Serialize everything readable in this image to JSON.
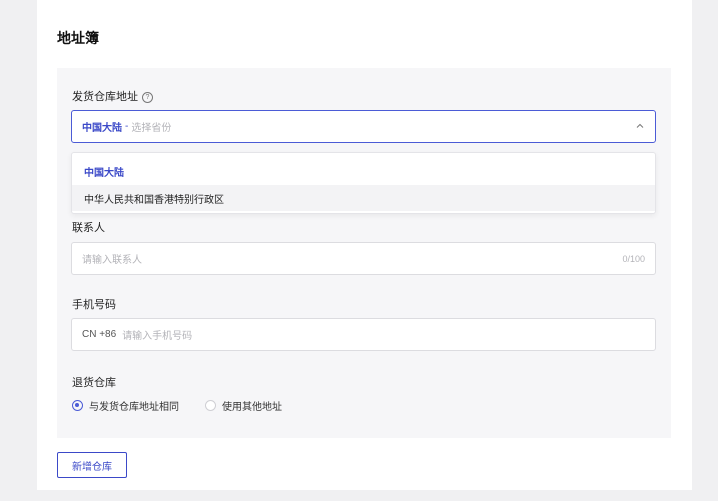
{
  "section_title": "地址簿",
  "ship_warehouse": {
    "label": "发货仓库地址",
    "help_glyph": "?",
    "selected_value": "中国大陆",
    "separator": "-",
    "placeholder": "选择省份",
    "options": [
      "中国大陆",
      "中华人民共和国香港特别行政区"
    ]
  },
  "contact": {
    "label": "联系人",
    "placeholder": "请输入联系人",
    "counter": "0/100"
  },
  "phone": {
    "label": "手机号码",
    "prefix": "CN +86",
    "placeholder": "请输入手机号码"
  },
  "return_warehouse": {
    "label": "退货仓库",
    "option_same": "与发货仓库地址相同",
    "option_other": "使用其他地址",
    "selected": "same"
  },
  "add_warehouse_button": "新增仓库",
  "colors": {
    "accent": "#3b49c8"
  },
  "icons": [
    "help-icon",
    "chevron-up-icon",
    "radio-selected-icon",
    "radio-unselected-icon"
  ]
}
